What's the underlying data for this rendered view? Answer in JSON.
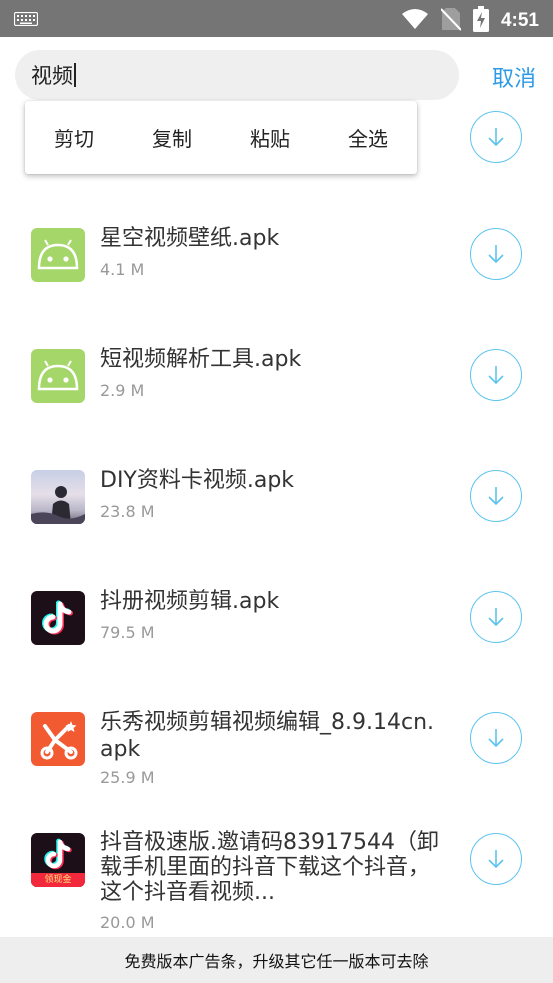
{
  "status_bar": {
    "time": "4:51",
    "icons": [
      "keyboard-icon",
      "wifi-icon",
      "no-sim-icon",
      "battery-charging-icon"
    ]
  },
  "search": {
    "query": "视频",
    "cancel_label": "取消"
  },
  "context_menu": {
    "items": [
      "剪切",
      "复制",
      "粘贴",
      "全选"
    ]
  },
  "files": [
    {
      "name": "",
      "size": "",
      "icon": "none"
    },
    {
      "name": "星空视频壁纸.apk",
      "size": "4.1 M",
      "icon": "android-icon"
    },
    {
      "name": "短视频解析工具.apk",
      "size": "2.9 M",
      "icon": "android-icon"
    },
    {
      "name": "DIY资料卡视频.apk",
      "size": "23.8 M",
      "icon": "photo-thumbnail-icon"
    },
    {
      "name": "抖册视频剪辑.apk",
      "size": "79.5 M",
      "icon": "tiktok-icon"
    },
    {
      "name": "乐秀视频剪辑视频编辑_8.9.14cn.apk",
      "size": "25.9 M",
      "icon": "videoshow-icon"
    },
    {
      "name": "抖音极速版.邀请码83917544（卸载手机里面的抖音下载这个抖音，这个抖音看视频...",
      "size": "20.0 M",
      "icon": "tiktok-lite-icon",
      "icon_badge": "领现金"
    }
  ],
  "ad_banner": {
    "text": "免费版本广告条，升级其它任一版本可去除"
  },
  "colors": {
    "accent": "#2e9ae8",
    "download_ring": "#5cc4f0",
    "android_green": "#a4d66a",
    "status_bar": "#757575"
  }
}
